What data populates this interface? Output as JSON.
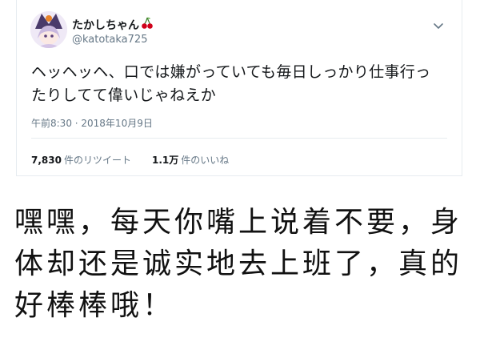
{
  "tweet": {
    "display_name": "たかしちゃん",
    "name_emoji": "🍒",
    "handle": "@katotaka725",
    "text": "ヘッヘッヘ、口では嫌がっていても毎日しっかり仕事行ったりしてて偉いじゃねえか",
    "timestamp": "午前8:30 · 2018年10月9日",
    "retweets": {
      "count": "7,830",
      "label": "件のリツイート"
    },
    "likes": {
      "count": "1.1万",
      "label": "件のいいね"
    },
    "menu_icon": "chevron-down-icon",
    "avatar": "avatar-image"
  },
  "caption": {
    "text": "嘿嘿，每天你嘴上说着不要，身体却还是诚实地去上班了，真的好棒棒哦！"
  },
  "colors": {
    "text_primary": "#14171a",
    "text_secondary": "#657786",
    "border": "#e6ecf0",
    "cherry": "#d0021b"
  }
}
